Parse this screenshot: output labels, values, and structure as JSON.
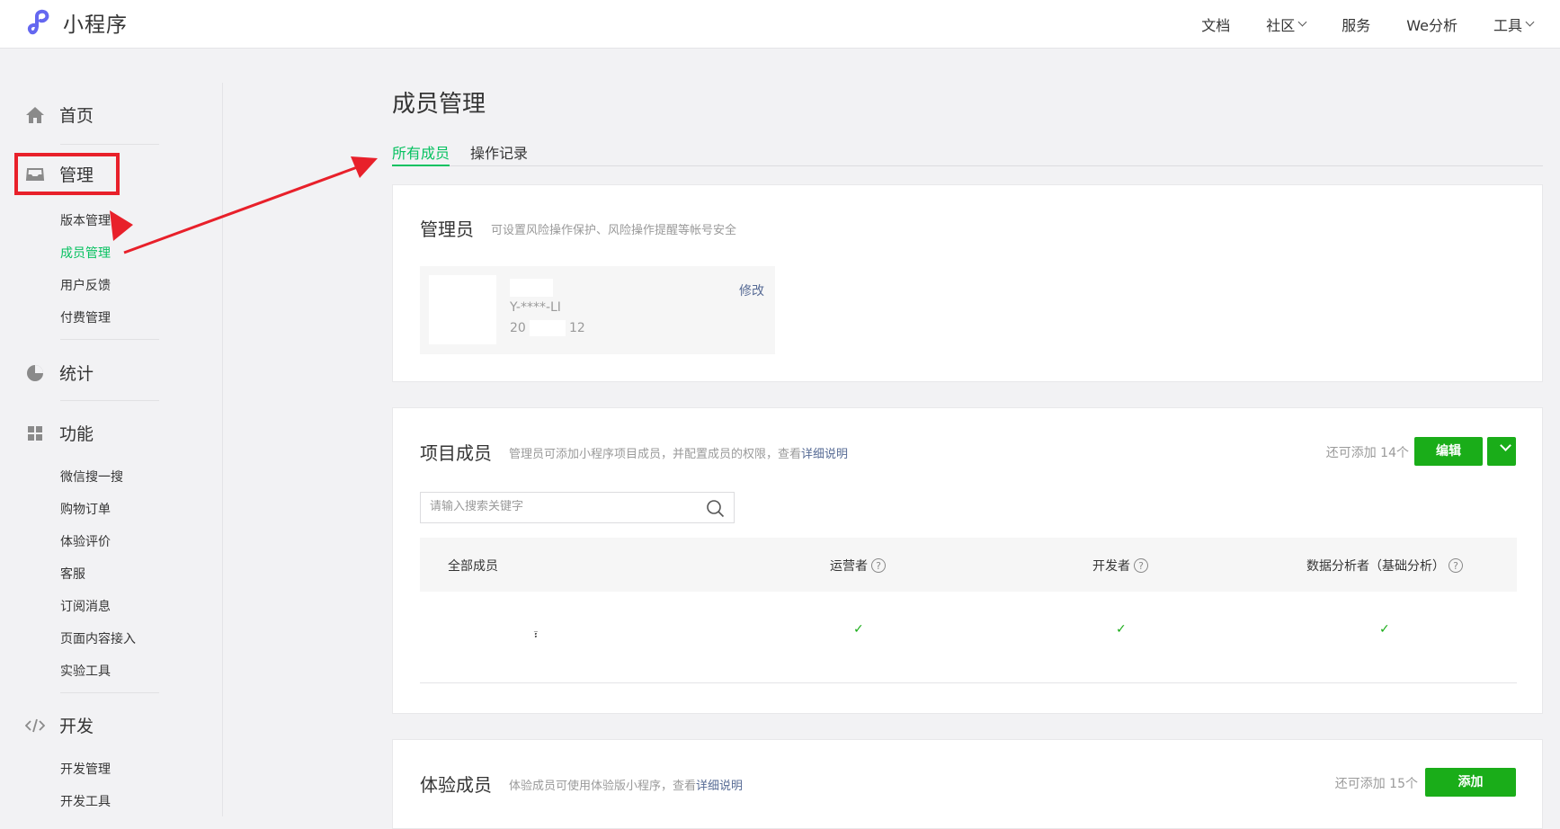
{
  "topbar": {
    "logo_text": "小程序",
    "nav": [
      {
        "label": "文档",
        "dropdown": false
      },
      {
        "label": "社区",
        "dropdown": true
      },
      {
        "label": "服务",
        "dropdown": false
      },
      {
        "label": "We分析",
        "dropdown": false
      },
      {
        "label": "工具",
        "dropdown": true
      }
    ]
  },
  "sidebar": {
    "home": "首页",
    "manage": {
      "label": "管理",
      "items": [
        "版本管理",
        "成员管理",
        "用户反馈",
        "付费管理"
      ],
      "active": "成员管理"
    },
    "stats": "统计",
    "features": {
      "label": "功能",
      "items": [
        "微信搜一搜",
        "购物订单",
        "体验评价",
        "客服",
        "订阅消息",
        "页面内容接入",
        "实验工具"
      ]
    },
    "dev": {
      "label": "开发",
      "items": [
        "开发管理",
        "开发工具"
      ]
    }
  },
  "main": {
    "title": "成员管理",
    "tabs": [
      {
        "label": "所有成员",
        "active": true
      },
      {
        "label": "操作记录",
        "active": false
      }
    ],
    "admin": {
      "title": "管理员",
      "desc": "可设置风险操作保护、风险操作提醒等帐号安全",
      "id": "Y-****-LI",
      "date_prefix": "20",
      "date_suffix": "12",
      "edit_label": "修改"
    },
    "project": {
      "title": "项目成员",
      "desc_prefix": "管理员可添加小程序项目成员，并配置成员的权限，查看",
      "desc_link": "详细说明",
      "quota": "还可添加 14个",
      "edit_button": "编辑",
      "search_placeholder": "请输入搜索关键字",
      "columns": [
        "全部成员",
        "运营者",
        "开发者",
        "数据分析者（基础分析）"
      ],
      "row": {
        "name": "፣",
        "ticks": [
          "✓",
          "✓",
          "✓"
        ]
      }
    },
    "trial": {
      "title": "体验成员",
      "desc_prefix": "体验成员可使用体验版小程序，查看",
      "desc_link": "详细说明",
      "quota": "还可添加 15个",
      "add_button": "添加"
    }
  },
  "colors": {
    "accent_green": "#07c160",
    "button_green": "#1aad19",
    "link_blue": "#576b95",
    "annotation_red": "#e8202a"
  }
}
